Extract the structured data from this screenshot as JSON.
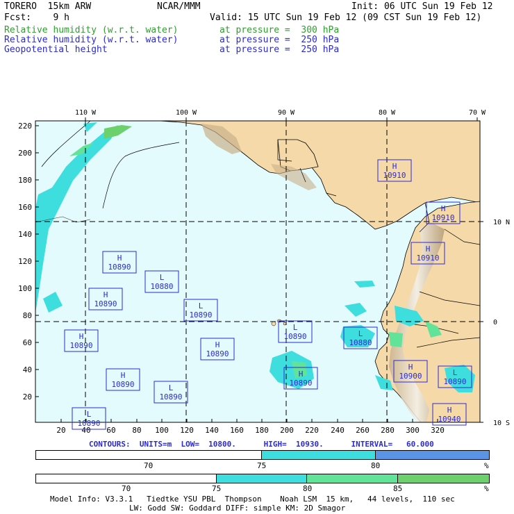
{
  "header": {
    "model": "TORERO  15km ARW",
    "center": "NCAR/MMM",
    "init": "Init: 06 UTC Sun 19 Feb 12",
    "fcst": "Fcst:    9 h",
    "valid": "Valid: 15 UTC Sun 19 Feb 12 (09 CST Sun 19 Feb 12)",
    "fields": [
      {
        "name": "Relative humidity (w.r.t. water)",
        "level": "at pressure =  300 hPa",
        "color": "#2e9e2e"
      },
      {
        "name": "Relative humidity (w.r.t. water)",
        "level": "at pressure =  250 hPa",
        "color": "#2b2bd6"
      },
      {
        "name": "Geopotential height",
        "level": "at pressure =  250 hPa",
        "color": "#2b2bd6"
      }
    ]
  },
  "colors": {
    "ocean": "#e3fbfd",
    "land": "#f5d9a8",
    "rh1": "#3fdede",
    "rh2": "#62e39a",
    "rh3": "#6cd06c",
    "rh_blue": "#5a95e5"
  },
  "map": {
    "lon_labels": [
      "110 W",
      "100 W",
      "90 W",
      "80 W",
      "70 W"
    ],
    "lat_labels": [
      "10 N",
      "0",
      "10 S"
    ],
    "y_ticks": [
      "220",
      "200",
      "180",
      "160",
      "140",
      "120",
      "100",
      "80",
      "60",
      "40",
      "20"
    ],
    "x_ticks": [
      "20",
      "40",
      "60",
      "80",
      "100",
      "120",
      "140",
      "160",
      "180",
      "200",
      "220",
      "240",
      "260",
      "280",
      "300",
      "320"
    ],
    "centers": [
      {
        "type": "H",
        "value": "10910"
      },
      {
        "type": "H",
        "value": "10910"
      },
      {
        "type": "H",
        "value": "10910"
      },
      {
        "type": "H",
        "value": "10890"
      },
      {
        "type": "L",
        "value": "10880"
      },
      {
        "type": "H",
        "value": "10890"
      },
      {
        "type": "L",
        "value": "10890"
      },
      {
        "type": "H",
        "value": "10890"
      },
      {
        "type": "L",
        "value": "10890"
      },
      {
        "type": "H",
        "value": "10890"
      },
      {
        "type": "L",
        "value": "10880"
      },
      {
        "type": "H",
        "value": "10890"
      },
      {
        "type": "H",
        "value": "10890"
      },
      {
        "type": "L",
        "value": "10890"
      },
      {
        "type": "H",
        "value": "10900"
      },
      {
        "type": "L",
        "value": "10890"
      },
      {
        "type": "H",
        "value": "10940"
      },
      {
        "type": "L",
        "value": "10890"
      }
    ]
  },
  "contours": {
    "text": "CONTOURS:  UNITS=m  LOW=  10800.      HIGH=  10930.      INTERVAL=   60.000"
  },
  "colorbar1": {
    "labels": [
      "70",
      "75",
      "80",
      "%"
    ]
  },
  "colorbar2": {
    "labels": [
      "70",
      "75",
      "80",
      "85",
      "%"
    ]
  },
  "footer": {
    "line1": "Model Info: V3.3.1   Tiedtke YSU PBL  Thompson    Noah LSM  15 km,   44 levels,  110 sec",
    "line2": "LW: Godd SW: Goddard DIFF: simple KM: 2D Smagor"
  }
}
